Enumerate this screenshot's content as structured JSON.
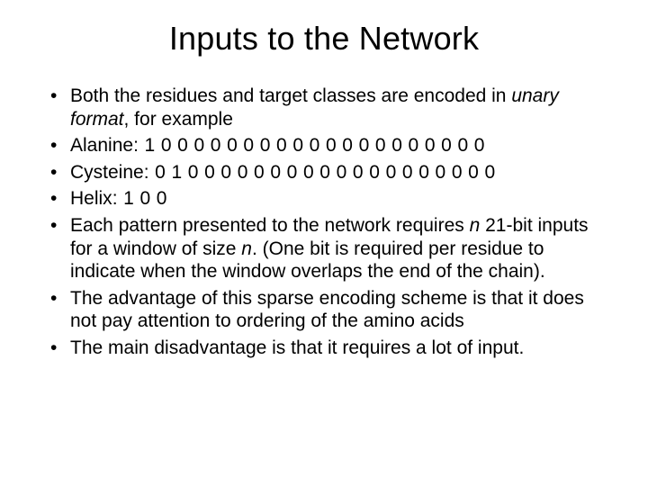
{
  "title": "Inputs to the Network",
  "bullets": {
    "b1_pre": "Both the residues and target classes are encoded in ",
    "b1_ital": "unary format",
    "b1_post": ", for example",
    "b2_label": "Alanine",
    "b2_code": ": 1 0 0 0 0 0 0 0 0 0 0 0 0 0 0 0 0 0 0 0 0",
    "b3_label": "Cysteine",
    "b3_code": ": 0 1 0 0 0 0 0 0 0 0 0 0 0 0 0 0 0 0 0 0 0",
    "b4_label": "Helix",
    "b4_code": ": 1 0 0",
    "b5_pre": "Each pattern presented to the network requires ",
    "b5_ital1": "n",
    "b5_mid": " 21-bit inputs for a window of size ",
    "b5_ital2": "n",
    "b5_post": ". (One bit is required per residue to  indicate when the window overlaps the end of the chain).",
    "b6": "The advantage of this sparse encoding scheme is that it does not pay attention to ordering of the amino acids",
    "b7": "The main disadvantage is that it requires a lot of input."
  }
}
